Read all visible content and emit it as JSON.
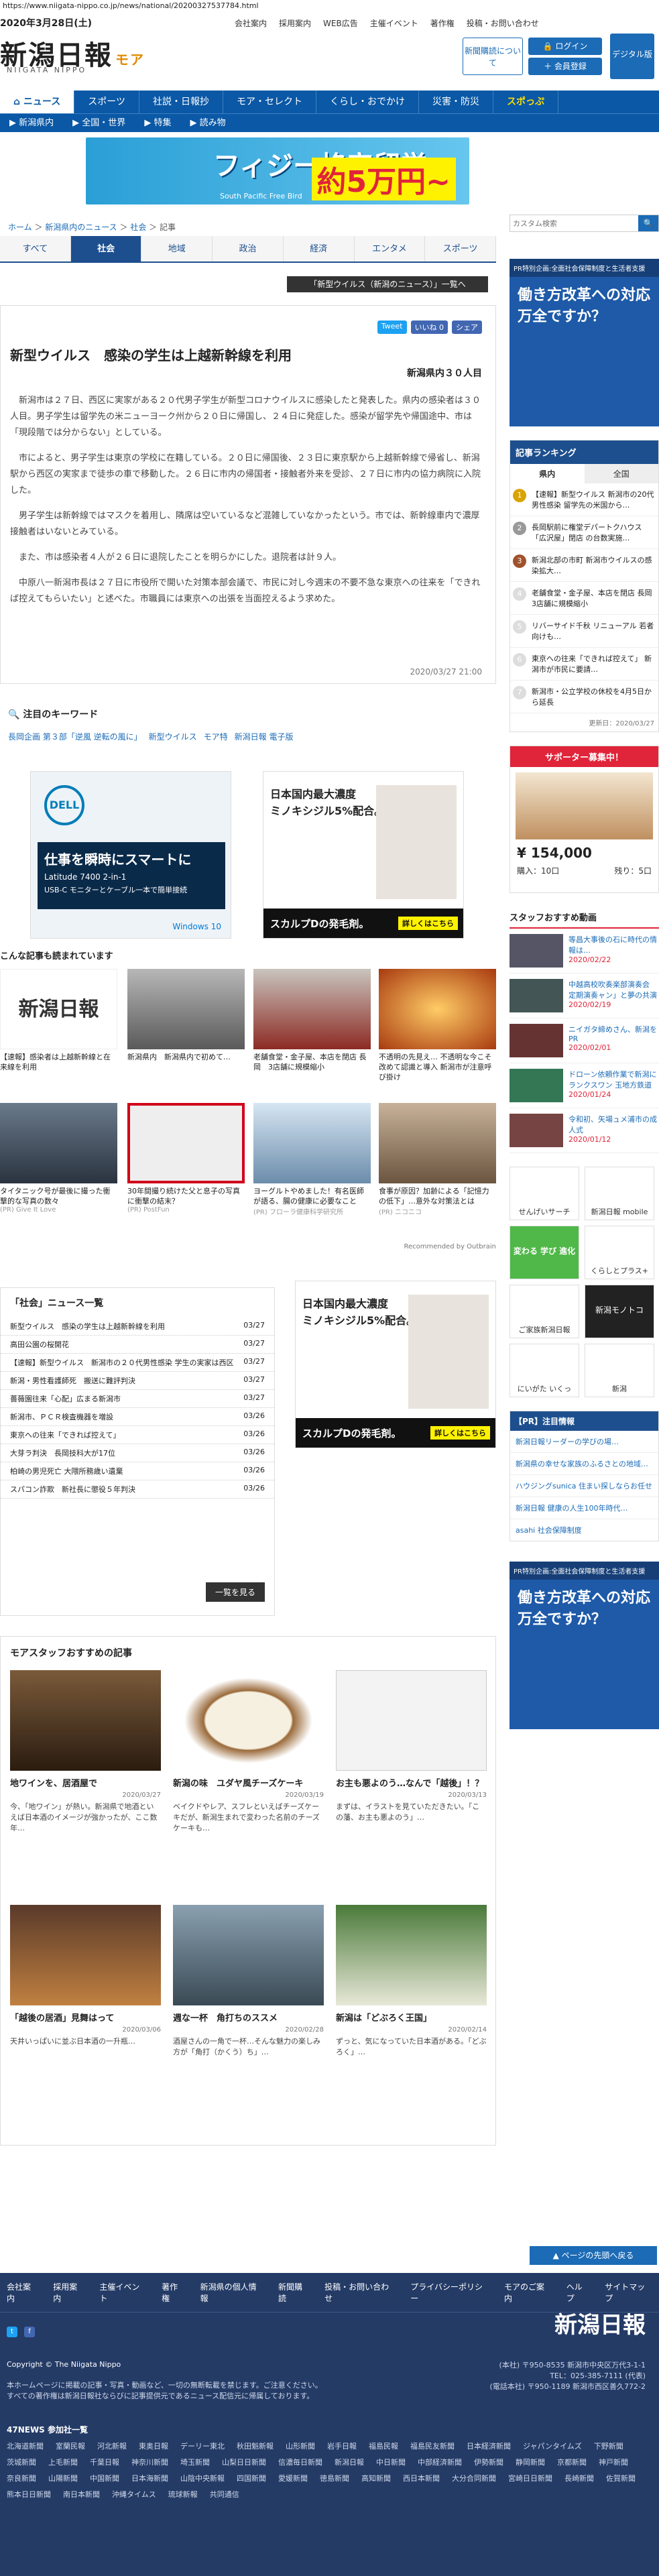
{
  "browser": {
    "url": "https://www.niigata-nippo.co.jp/news/national/20200327537784.html"
  },
  "header": {
    "date": "2020年3月28日(土)",
    "logo": "新潟日報",
    "logo_sub": "NIIGATA NIPPO",
    "logo_more": "モア",
    "top_links": [
      "会社案内",
      "採用案内",
      "WEB広告",
      "主催イベント",
      "著作権",
      "投稿・お問い合わせ"
    ],
    "user_button": "新聞購読について",
    "login": "ログイン",
    "register": "会員登録",
    "digital": "デジタル版"
  },
  "nav": {
    "main": [
      "ニュース",
      "スポーツ",
      "社説・日報抄",
      "モア・セレクト",
      "くらし・おでかけ",
      "災害・防災",
      "スポっぷ"
    ],
    "sub": [
      "新潟県内",
      "全国・世界",
      "特集",
      "読み物"
    ]
  },
  "banner": {
    "text": "フィジー格安留学",
    "price": "約5万円~",
    "brand": "South Pacific Free Bird"
  },
  "breadcrumb": [
    "ホーム",
    "新潟県内のニュース",
    "社会",
    "記事"
  ],
  "tabs": [
    "すべて",
    "社会",
    "地域",
    "政治",
    "経済",
    "エンタメ",
    "スポーツ"
  ],
  "topic_link": "「新型ウイルス（新潟のニュース）」一覧へ",
  "share": [
    "Tweet",
    "いいね 0",
    "シェア"
  ],
  "article": {
    "title": "新型ウイルス　感染の学生は上越新幹線を利用",
    "place": "新潟県内３０人目",
    "paragraphs": [
      "新潟市は２７日、西区に実家がある２０代男子学生が新型コロナウイルスに感染したと発表した。県内の感染者は３０人目。男子学生は留学先の米ニューヨーク州から２０日に帰国し、２４日に発症した。感染が留学先や帰国途中、市は「現段階では分からない」としている。",
      "市によると、男子学生は東京の学校に在籍している。２０日に帰国後、２３日に東京駅から上越新幹線で帰省し、新潟駅から西区の実家まで徒歩の車で移動した。２６日に市内の帰国者・接触者外来を受診、２７日に市内の協力病院に入院した。",
      "男子学生は新幹線ではマスクを着用し、隣席は空いているなど混雑していなかったという。市では、新幹線車内で濃厚接触者はいないとみている。",
      "また、市は感染者４人が２６日に退院したことを明らかにした。退院者は計９人。",
      "中原八一新潟市長は２７日に市役所で開いた対策本部会議で、市民に対し今週末の不要不急な東京への往来を「できれば控えてもらいたい」と述べた。市職員には東京への出張を当面控えるよう求めた。"
    ],
    "timestamp": "2020/03/27 21:00"
  },
  "keywords": {
    "heading": "注目のキーワード",
    "items": [
      "長岡企画 第３部「逆風 逆転の風に」",
      "新型ウイルス",
      "モア特",
      "新潟日報 電子版"
    ]
  },
  "ads": {
    "dell_title": "仕事を瞬時にスマートに",
    "dell_sub": "Latitude 7400 2-in-1",
    "dell_note": "USB-C モニターとケーブル一本で簡単接続",
    "dell_os": "Windows 10",
    "fuji_title": "日本国内最大濃度",
    "fuji_sub": "ミノキシジル5%配合。",
    "fuji_foot": "スカルプDの発毛剤。",
    "fuji_btn": "詳しくはこちら"
  },
  "recommend": {
    "heading": "こんな記事も読まれています",
    "items": [
      {
        "caption": "【速報】感染者は上越新幹線と在来線を利用",
        "source": ""
      },
      {
        "caption": "新潟県内　新潟県内で初めて…",
        "source": ""
      },
      {
        "caption": "老舗食堂・金子屋、本店を閉店 長岡　3店舗に規模縮小",
        "source": ""
      },
      {
        "caption": "不透明の先見え… 不透明な今こそ改めて認識と導入 新潟市が注意呼び掛け",
        "source": ""
      },
      {
        "caption": "タイタニック号が最後に撮った衝撃的な写真の数々",
        "source": "(PR) Give It Love"
      },
      {
        "caption": "30年間撮り続けた父と息子の写真に衝撃の結末？",
        "source": "(PR) PostFun"
      },
      {
        "caption": "ヨーグルトやめました！有名医師が語る、腸の健康に必要なこと",
        "source": "(PR) フローラ健康科学研究所"
      },
      {
        "caption": "食事が原因？加齢による「記憶力の低下」…意外な対策法とは",
        "source": "(PR) ニコニコ"
      }
    ],
    "recommended_by": "Recommended by Outbrain"
  },
  "social_news": {
    "heading": "「社会」ニュース一覧",
    "rows": [
      {
        "title": "新型ウイルス　感染の学生は上越新幹線を利用",
        "date": "03/27"
      },
      {
        "title": "高田公園の桜開花",
        "date": "03/27"
      },
      {
        "title": "【速報】新型ウイルス　新潟市の２０代男性感染 学生の実家は西区",
        "date": "03/27"
      },
      {
        "title": "新潟・男性看護師死　搬送に難評判決",
        "date": "03/27"
      },
      {
        "title": "薔薇園往来「心配」広まる新潟市",
        "date": "03/27"
      },
      {
        "title": "新潟市、ＰＣＲ検査機器を増設",
        "date": "03/26"
      },
      {
        "title": "東京への往来「できれば控えて」",
        "date": "03/26"
      },
      {
        "title": "大芽ラ判決　長岡技科大が17位",
        "date": "03/26"
      },
      {
        "title": "柏崎の男児死亡 大隈所務歳い遺棄",
        "date": "03/26"
      },
      {
        "title": "スパコン詐欺　新社長に懲役５年判決",
        "date": "03/26"
      }
    ],
    "more": "一覧を見る"
  },
  "staff_picks": {
    "heading": "モアスタッフおすすめの記事",
    "cards": [
      {
        "title": "地ワインを、居酒屋で",
        "date": "2020/03/27",
        "excerpt": "今、「地ワイン」が熱い。新潟県で地酒といえば日本酒のイメージが強かったが、ここ数年…"
      },
      {
        "title": "新潟の味　ユダヤ風チーズケーキ",
        "date": "2020/03/19",
        "excerpt": "ベイクドやレア、スフレといえばチーズケーキだが、新潟生まれで変わった名前のチーズケーキも…"
      },
      {
        "title": "お主も悪よのう…なんで「越後」！？",
        "date": "2020/03/13",
        "excerpt": "まずは、イラストを見ていただきたい。「この藩、お主も悪よのう」…"
      },
      {
        "title": "「越後の居酒」見舞はって",
        "date": "2020/03/06",
        "excerpt": "天井いっぱいに並ぶ日本酒の一升瓶…"
      },
      {
        "title": "週な一杯　角打ちのススメ",
        "date": "2020/02/28",
        "excerpt": "酒屋さんの一角で一杯…そんな魅力の楽しみ方が「角打（かくう）ち」…"
      },
      {
        "title": "新潟は「どぶろく王国」",
        "date": "2020/02/14",
        "excerpt": "ずっと、気になっていた日本酒がある。「どぶろく」…"
      }
    ]
  },
  "sidebar": {
    "search_placeholder": "カスタム検索",
    "ad1_head": "PR特別企画:全面社会保障制度と生活者支援",
    "ad1_title": "働き方改革への対応万全ですか？",
    "ranking_head": "記事ランキング",
    "ranking_tabs": [
      "県内",
      "全国"
    ],
    "ranking": [
      "【速報】新型ウイルス 新潟市の20代男性感染 留学先の米国から…",
      "長岡駅前に権堂デパートクハウス「広沢屋」閉店 の台数実施…",
      "新潟北部の市町 新潟市ウイルスの感染拡大…",
      "老舗食堂・金子屋、本店を閉店 長岡 3店舗に規模縮小",
      "リバーサイド千秋 リニューアル 若者向けも…",
      "東京への往来「できれば控えて」 新潟市が市民に要請…",
      "新潟市・公立学校の休校を4月5日から延長"
    ],
    "updated": "更新日：2020/03/27",
    "supporter_head": "サポーター募集中！",
    "product_price": "¥ 154,000",
    "product_row": [
      "購入：10口",
      "残り：5口"
    ],
    "staff_head": "スタッフおすすめ動画",
    "staff_items": [
      {
        "title": "等昌大事後の石に時代の情報は…",
        "date": "2020/02/22"
      },
      {
        "title": "中越高校吹奏楽部演奏会 定期演奏ャン」と夢の共演",
        "date": "2020/02/19"
      },
      {
        "title": "ニイガタ締めさん、新潟をPR",
        "date": "2020/02/01"
      },
      {
        "title": "ドローン依頼作業で新潟にランクスワン 玉地方鉄道",
        "date": "2020/01/24"
      },
      {
        "title": "令和初、矢場ュメ浦市の成人式",
        "date": "2020/01/12"
      }
    ],
    "app_links": [
      "せんげいサーチ",
      "新潟日報 mobile",
      "変わる 学び 進化",
      "くらしとプラス+",
      "ご家族新潟日報",
      "新潟モノトコ",
      "にいがた いくっ",
      "新潟"
    ],
    "pr_head": "【PR】注目情報",
    "pr_items": [
      "新潟日報リーダーの学びの場…",
      "新潟県の幸せな家族のふるさとの地域…",
      "ハウジングsunica 住まい探しならお任せ",
      "新潟日報 健康の人生100年時代…",
      "asahi 社会保障制度"
    ],
    "scroll_top": "ページの先頭へ戻る"
  },
  "footer": {
    "links": [
      "会社案内",
      "採用案内",
      "主催イベント",
      "著作権",
      "新潟県の個人情報",
      "新聞購読",
      "投稿・お問い合わせ",
      "プライバシーポリシー",
      "モアのご案内",
      "ヘルプ",
      "サイトマップ"
    ],
    "copyright": "Copyright © The Niigata Nippo",
    "notes": [
      "本ホームページに掲載の記事・写真・動画など、一切の無断転載を禁じます。ご注意ください。",
      "すべての著作権は新潟日報社ならびに記事提供元であるニュース配信元に帰属しております。"
    ],
    "logo": "新潟日報",
    "address": [
      "(本社) 〒950-8535 新潟市中央区万代3-1-1",
      "TEL：025-385-7111 (代表)",
      "(電話本社) 〒950-1189 新潟市西区善久772-2"
    ],
    "links47_head": "47NEWS 参加社一覧",
    "links47": [
      "北海道新聞",
      "室蘭民報",
      "河北新報",
      "東奥日報",
      "デーリー東北",
      "秋田魁新報",
      "山形新聞",
      "岩手日報",
      "福島民報",
      "福島民友新聞",
      "日本経済新聞",
      "ジャパンタイムズ",
      "下野新聞",
      "茨城新聞",
      "上毛新聞",
      "千葉日報",
      "神奈川新聞",
      "埼玉新聞",
      "山梨日日新聞",
      "信濃毎日新聞",
      "新潟日報",
      "中日新聞",
      "中部経済新聞",
      "伊勢新聞",
      "静岡新聞",
      "京都新聞",
      "神戸新聞",
      "奈良新聞",
      "山陽新聞",
      "中国新聞",
      "日本海新聞",
      "山陰中央新報",
      "四国新聞",
      "愛媛新聞",
      "徳島新聞",
      "高知新聞",
      "西日本新聞",
      "大分合同新聞",
      "宮崎日日新聞",
      "長崎新聞",
      "佐賀新聞",
      "熊本日日新聞",
      "南日本新聞",
      "沖縄タイムス",
      "琉球新報",
      "共同通信"
    ]
  },
  "colors": {
    "brand": "#0a58a6",
    "tab_active": "#1d4f8e",
    "accent": "#e0243a"
  }
}
